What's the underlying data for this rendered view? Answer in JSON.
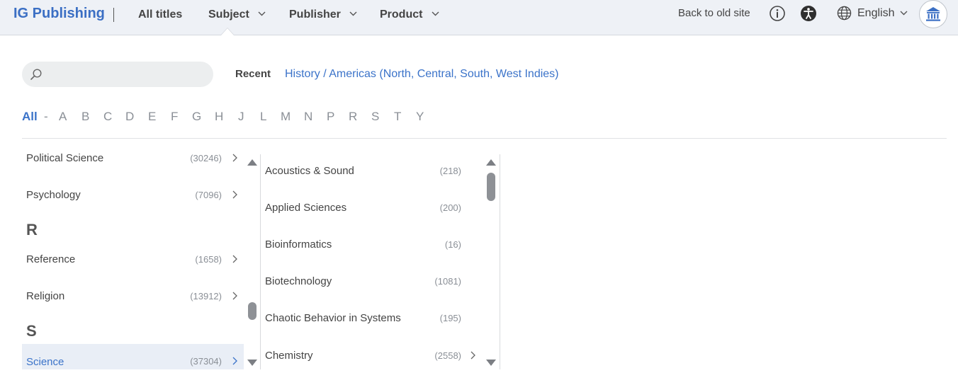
{
  "header": {
    "logo": "IG Publishing",
    "nav": [
      {
        "label": "All titles",
        "has_dropdown": false
      },
      {
        "label": "Subject",
        "has_dropdown": true
      },
      {
        "label": "Publisher",
        "has_dropdown": true
      },
      {
        "label": "Product",
        "has_dropdown": true
      }
    ],
    "back_link": "Back to old site",
    "language": "English",
    "icons": [
      "info-icon",
      "accessibility-icon",
      "globe-icon",
      "institution-icon"
    ]
  },
  "search": {
    "value": "",
    "placeholder": ""
  },
  "recent": {
    "label": "Recent",
    "link": "History / Americas (North, Central, South, West Indies)"
  },
  "alphabet": {
    "active": "All",
    "separator": "-",
    "letters": [
      "A",
      "B",
      "C",
      "D",
      "E",
      "F",
      "G",
      "H",
      "J",
      "L",
      "M",
      "N",
      "P",
      "R",
      "S",
      "T",
      "Y"
    ]
  },
  "left_column": {
    "items": [
      {
        "type": "item",
        "label": "Political Science",
        "count": "(30246)"
      },
      {
        "type": "item",
        "label": "Psychology",
        "count": "(7096)"
      },
      {
        "type": "letter",
        "label": "R"
      },
      {
        "type": "item",
        "label": "Reference",
        "count": "(1658)"
      },
      {
        "type": "item",
        "label": "Religion",
        "count": "(13912)"
      },
      {
        "type": "letter",
        "label": "S"
      },
      {
        "type": "item",
        "label": "Science",
        "count": "(37304)",
        "selected": true
      }
    ]
  },
  "right_column": {
    "items": [
      {
        "label": "Acoustics & Sound",
        "count": "(218)",
        "has_children": false
      },
      {
        "label": "Applied Sciences",
        "count": "(200)",
        "has_children": false
      },
      {
        "label": "Bioinformatics",
        "count": "(16)",
        "has_children": false
      },
      {
        "label": "Biotechnology",
        "count": "(1081)",
        "has_children": false
      },
      {
        "label": "Chaotic Behavior in Systems",
        "count": "(195)",
        "has_children": false
      },
      {
        "label": "Chemistry",
        "count": "(2558)",
        "has_children": true
      }
    ]
  },
  "colors": {
    "accent": "#3b73c9",
    "logo": "#3b6fc4",
    "topbar_bg": "#eef1f6",
    "selected_bg": "#e9eef6"
  }
}
